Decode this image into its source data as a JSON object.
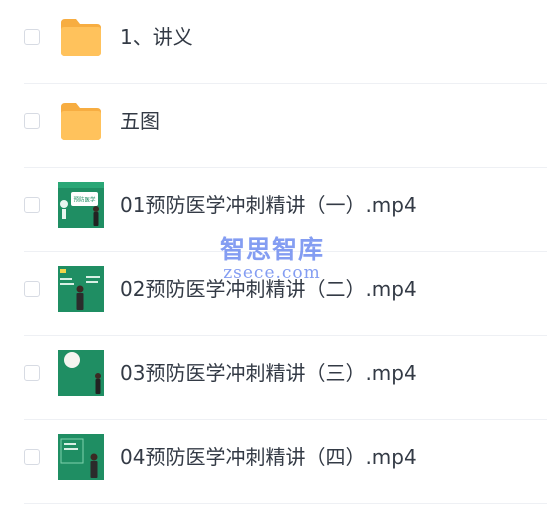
{
  "files": [
    {
      "name": "1、讲义",
      "type": "folder",
      "icon": "folder-icon"
    },
    {
      "name": "五图",
      "type": "folder",
      "icon": "folder-icon"
    },
    {
      "name": "01预防医学冲刺精讲（一）.mp4",
      "type": "video",
      "icon": "video-thumbnail",
      "thumb_label": "预防医学"
    },
    {
      "name": "02预防医学冲刺精讲（二）.mp4",
      "type": "video",
      "icon": "video-thumbnail"
    },
    {
      "name": "03预防医学冲刺精讲（三）.mp4",
      "type": "video",
      "icon": "video-thumbnail"
    },
    {
      "name": "04预防医学冲刺精讲（四）.mp4",
      "type": "video",
      "icon": "video-thumbnail"
    }
  ],
  "watermark": {
    "cn": "智思智库",
    "en": "zsece.com"
  },
  "colors": {
    "folder": "#ffc25c",
    "folder_back": "#f7ad41",
    "video_bg": "#1f8e63",
    "text": "#333a45",
    "divider": "#eef0f4",
    "watermark": "#6f8df0"
  }
}
